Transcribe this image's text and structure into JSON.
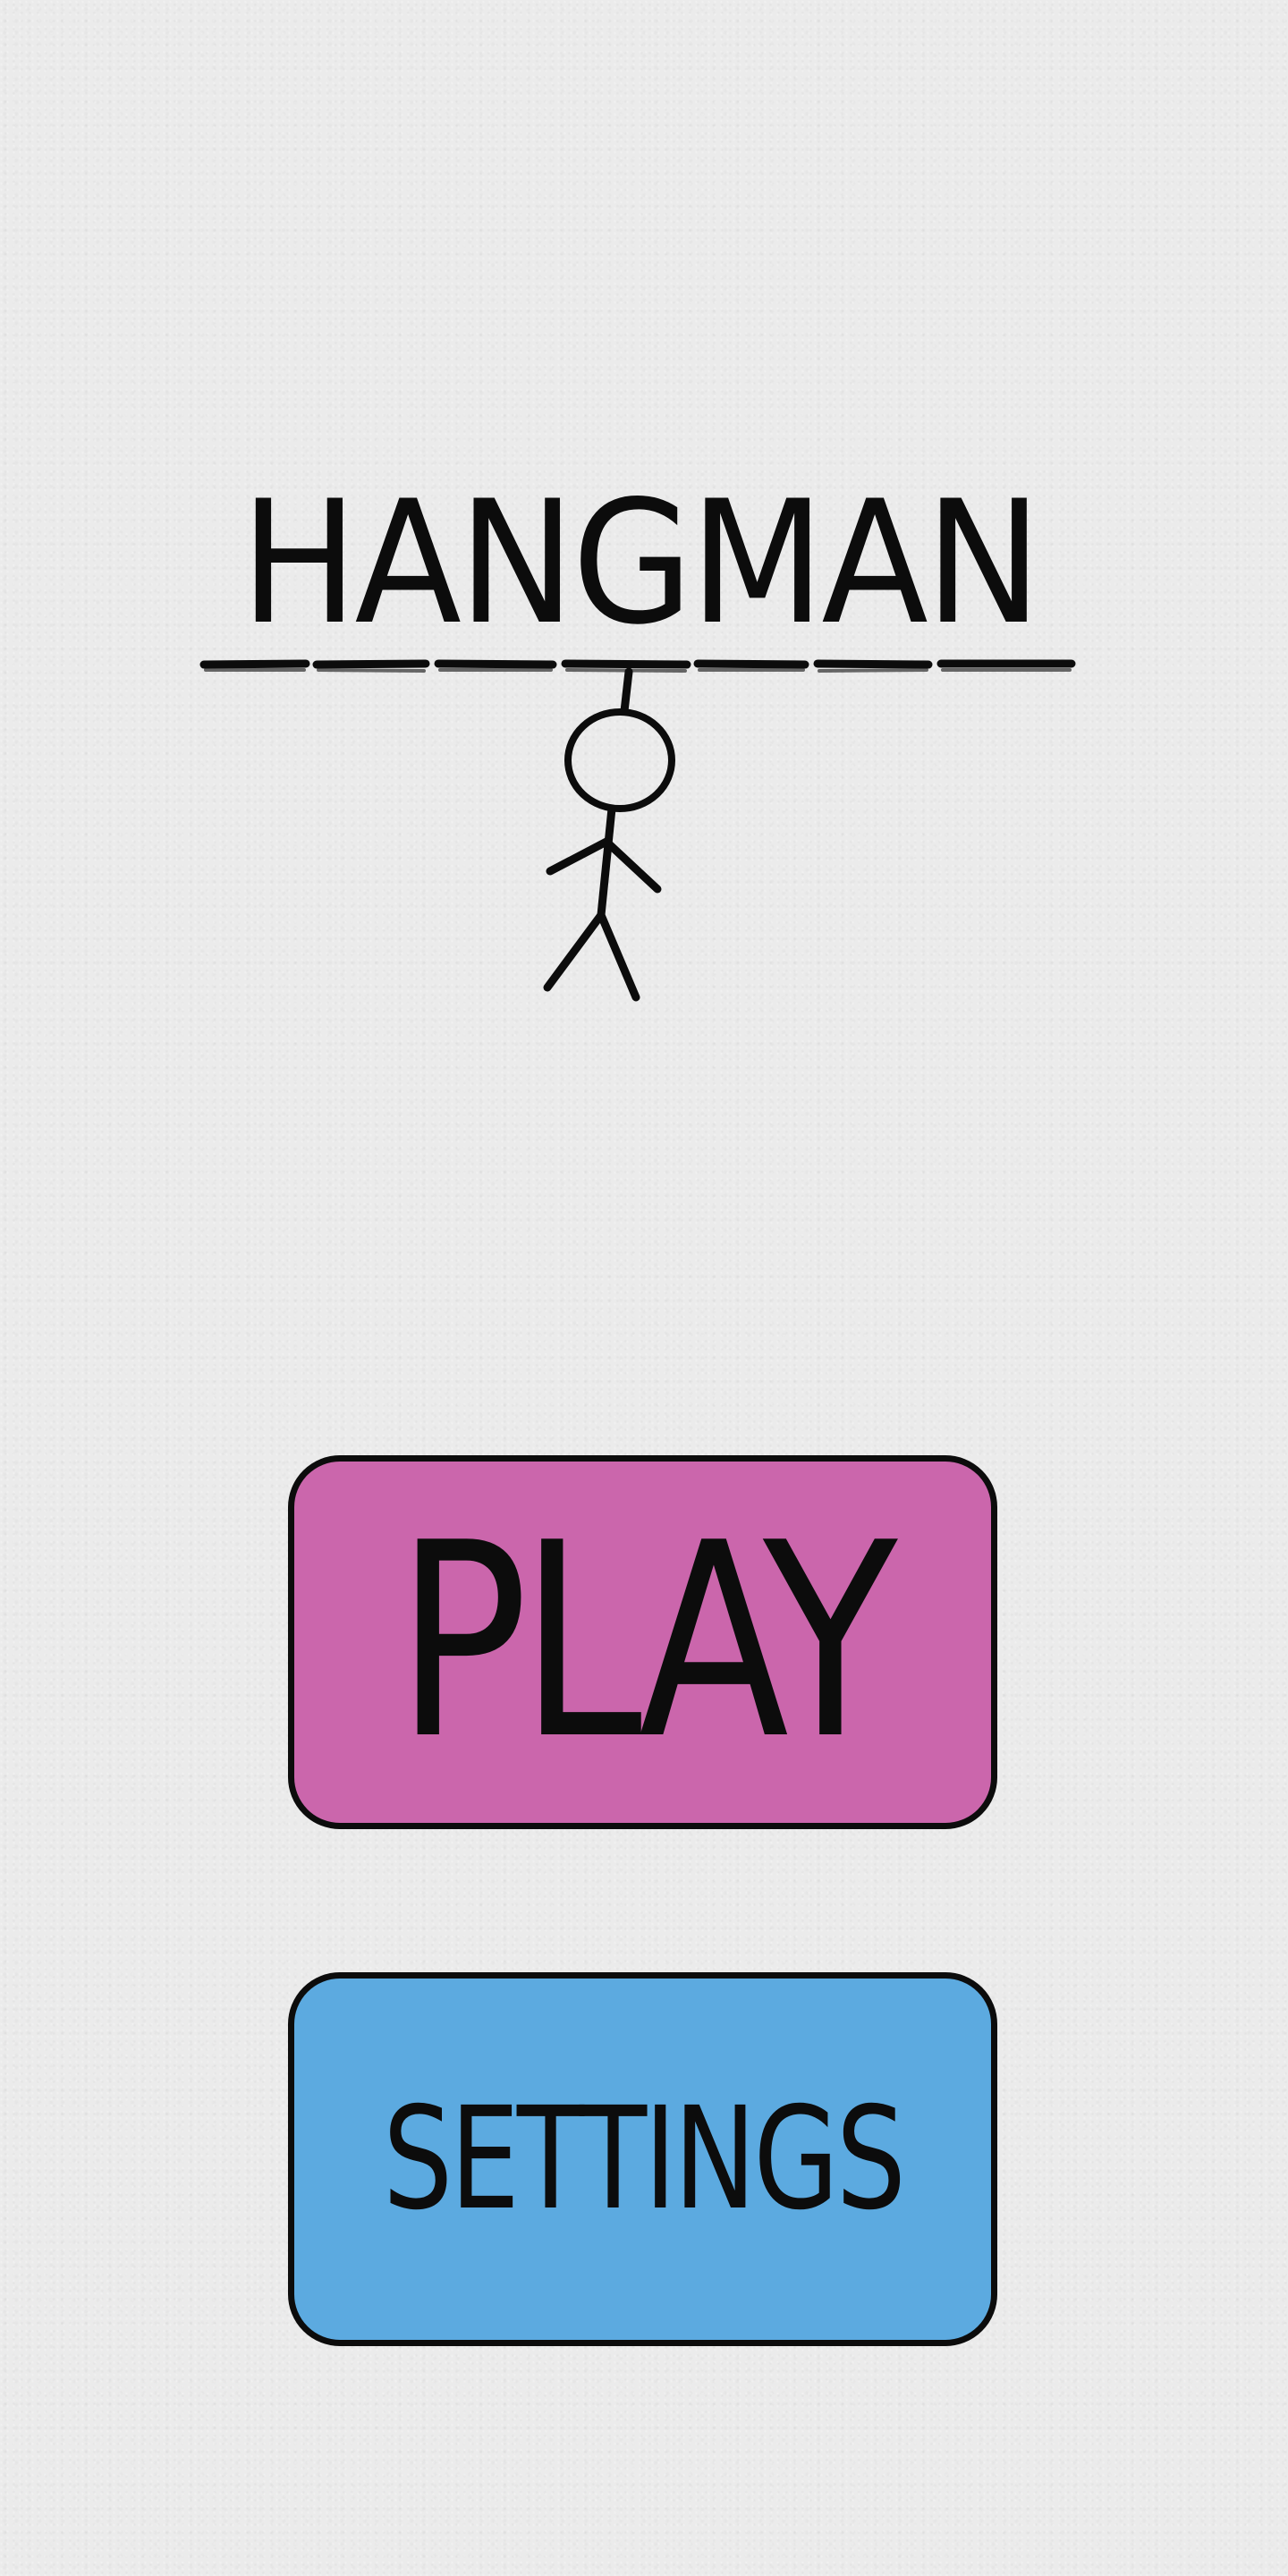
{
  "logo": {
    "title": "HANGMAN"
  },
  "menu": {
    "play_label": "PLAY",
    "settings_label": "SETTINGS"
  },
  "colors": {
    "background": "#ebebeb",
    "ink": "#0c0c0c",
    "play_button": "#cb66ac",
    "settings_button": "#5caae0"
  },
  "icons": {
    "logo_figure": "hanging-stick-figure-icon"
  }
}
